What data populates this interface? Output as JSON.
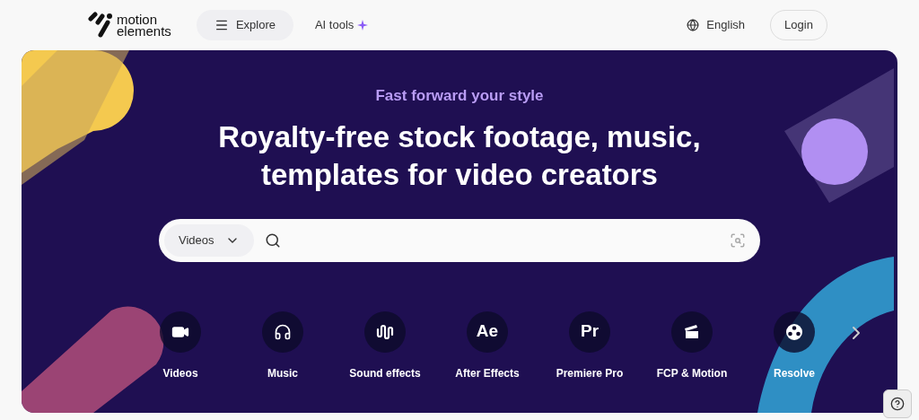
{
  "nav": {
    "logo_top": "motion",
    "logo_bottom": "elements",
    "explore": "Explore",
    "ai_tools": "AI tools",
    "language": "English",
    "login": "Login"
  },
  "hero": {
    "kicker": "Fast forward your style",
    "headline_line1": "Royalty-free stock footage, music,",
    "headline_line2": "templates for video creators"
  },
  "search": {
    "category": "Videos"
  },
  "categories": [
    {
      "label": "Videos",
      "kind": "video"
    },
    {
      "label": "Music",
      "kind": "headphones"
    },
    {
      "label": "Sound effects",
      "kind": "wave"
    },
    {
      "label": "After Effects",
      "kind": "glyph",
      "glyph": "Ae"
    },
    {
      "label": "Premiere Pro",
      "kind": "glyph",
      "glyph": "Pr"
    },
    {
      "label": "FCP & Motion",
      "kind": "clapper"
    },
    {
      "label": "Resolve",
      "kind": "reel"
    }
  ]
}
